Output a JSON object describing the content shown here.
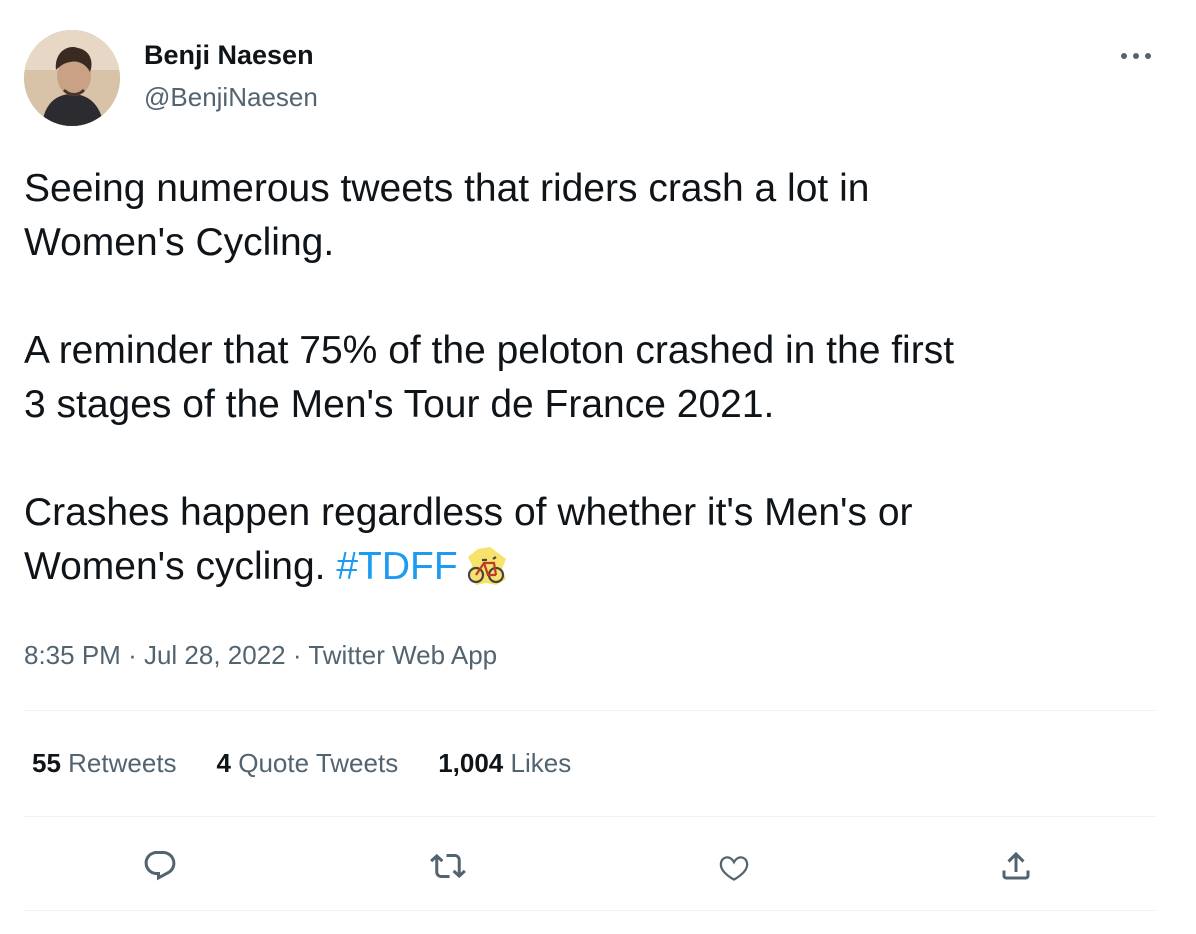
{
  "author": {
    "name": "Benji Naesen",
    "handle": "@BenjiNaesen"
  },
  "tweet": {
    "line1": "Seeing numerous tweets that riders crash a lot in",
    "line2": "Women's Cycling.",
    "line3": "A reminder that 75% of the peloton crashed in the first",
    "line4": "3 stages of the Men's Tour de France 2021.",
    "line5": "Crashes happen regardless of whether it's Men's or",
    "line6": "Women's cycling.",
    "hashtag": "#TDFF"
  },
  "meta": {
    "time": "8:35 PM",
    "separator": "·",
    "date": "Jul 28, 2022",
    "source": "Twitter Web App"
  },
  "stats": {
    "retweets_count": "55",
    "retweets_label": "Retweets",
    "quotes_count": "4",
    "quotes_label": "Quote Tweets",
    "likes_count": "1,004",
    "likes_label": "Likes"
  },
  "icons": {
    "more": "more-horizontal-icon",
    "reply": "reply-icon",
    "retweet": "retweet-icon",
    "like": "heart-icon",
    "share": "share-icon",
    "emoji": "france-bicycle-emoji"
  },
  "colors": {
    "text": "#0f1419",
    "secondary": "#536471",
    "link": "#1d9bf0",
    "divider": "#eff3f4"
  }
}
